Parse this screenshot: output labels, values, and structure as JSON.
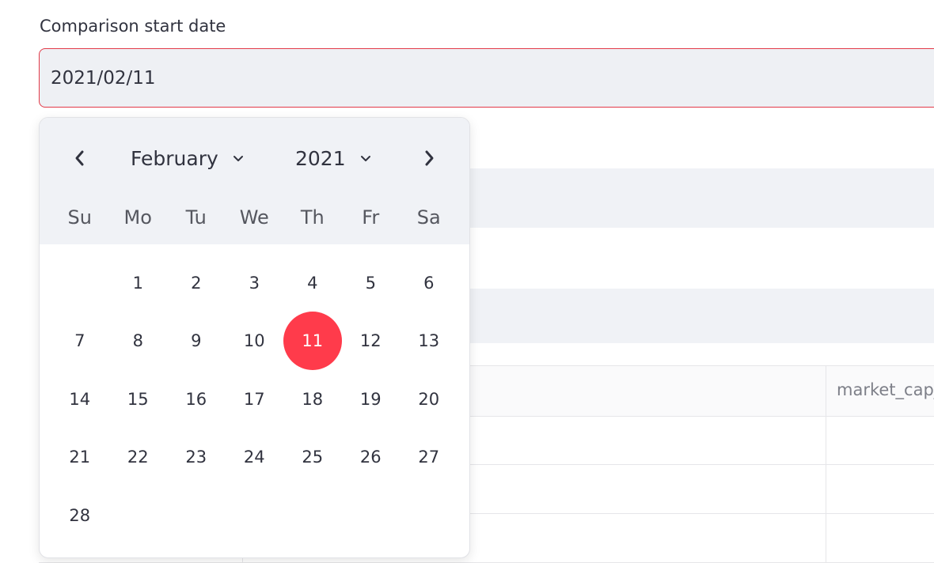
{
  "field": {
    "label": "Comparison start date",
    "value": "2021/02/11"
  },
  "table": {
    "column_header": "market_cap_"
  },
  "calendar": {
    "month": "February",
    "year": "2021",
    "weekdays": [
      "Su",
      "Mo",
      "Tu",
      "We",
      "Th",
      "Fr",
      "Sa"
    ],
    "first_weekday_index": 1,
    "days": [
      "1",
      "2",
      "3",
      "4",
      "5",
      "6",
      "7",
      "8",
      "9",
      "10",
      "11",
      "12",
      "13",
      "14",
      "15",
      "16",
      "17",
      "18",
      "19",
      "20",
      "21",
      "22",
      "23",
      "24",
      "25",
      "26",
      "27",
      "28"
    ],
    "selected_day": "11",
    "icons": {
      "prev": "chevron-left-icon",
      "next": "chevron-right-icon",
      "dropdown": "chevron-down-icon"
    }
  },
  "colors": {
    "accent": "#ff3b4b",
    "input_border": "#e23a48",
    "input_background": "#eef0f4",
    "header_background": "#f0f2f6"
  }
}
